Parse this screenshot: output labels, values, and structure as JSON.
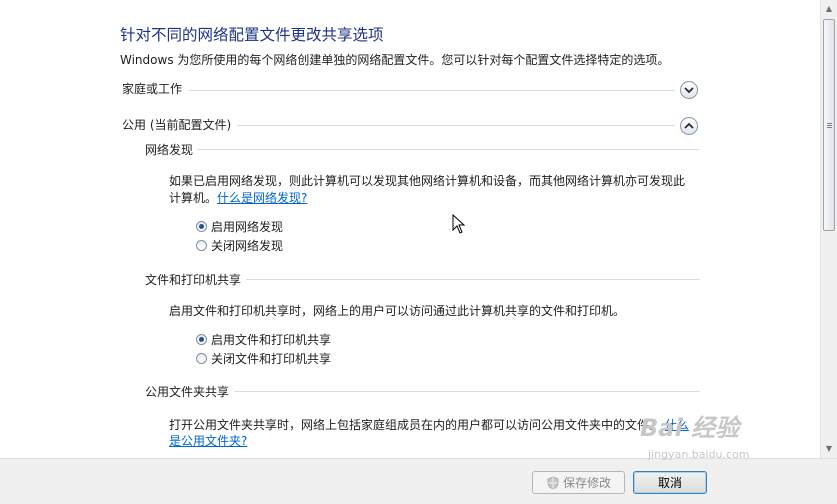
{
  "page": {
    "title": "针对不同的网络配置文件更改共享选项",
    "description": "Windows 为您所使用的每个网络创建单独的网络配置文件。您可以针对每个配置文件选择特定的选项。"
  },
  "profiles": {
    "home": {
      "label": "家庭或工作",
      "expanded": false,
      "toggle_icon": "chevron-down-icon"
    },
    "public": {
      "label": "公用 (当前配置文件)",
      "expanded": true,
      "toggle_icon": "chevron-up-icon"
    }
  },
  "network_discovery": {
    "heading": "网络发现",
    "body_line1": "如果已启用网络发现，则此计算机可以发现其他网络计算机和设备，而其他网络计算机亦可发现此",
    "body_line2": "计算机。",
    "link": "什么是网络发现?",
    "options": [
      {
        "label": "启用网络发现",
        "checked": true
      },
      {
        "label": "关闭网络发现",
        "checked": false
      }
    ]
  },
  "file_printer_sharing": {
    "heading": "文件和打印机共享",
    "body": "启用文件和打印机共享时，网络上的用户可以访问通过此计算机共享的文件和打印机。",
    "options": [
      {
        "label": "启用文件和打印机共享",
        "checked": true
      },
      {
        "label": "关闭文件和打印机共享",
        "checked": false
      }
    ]
  },
  "public_folder_sharing": {
    "heading": "公用文件夹共享",
    "body": "打开公用文件夹共享时，网络上包括家庭组成员在内的用户都可以访问公用文件夹中的文件。",
    "link_part1": "什么",
    "link_part2": "是公用文件夹?"
  },
  "footer": {
    "save_label": "保存修改",
    "save_enabled": false,
    "cancel_label": "取消"
  },
  "watermark": {
    "brand": "Bai 经验",
    "url": "jingyan.baidu.com"
  },
  "colors": {
    "title": "#1e3287",
    "link": "#0066cc",
    "radio_dot": "#24508f"
  }
}
